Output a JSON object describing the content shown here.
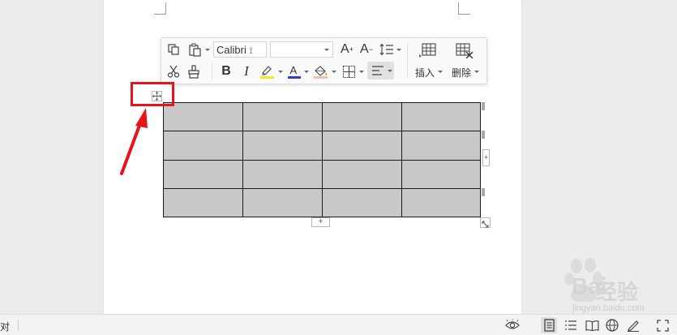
{
  "toolbar": {
    "font_name": "Calibri",
    "font_size": "",
    "insert_label": "插入",
    "delete_label": "删除"
  },
  "table": {
    "rows": 4,
    "cols": 4,
    "cell_fill": "#c8c8c8",
    "border_color": "#1a1a1a"
  },
  "annotation": {
    "color": "#e8141c"
  },
  "statusbar": {
    "left_text": "对"
  },
  "watermark": {
    "brand_latin": "Bai",
    "brand_cn": "经验",
    "url": "jingyan.baidu.com"
  }
}
